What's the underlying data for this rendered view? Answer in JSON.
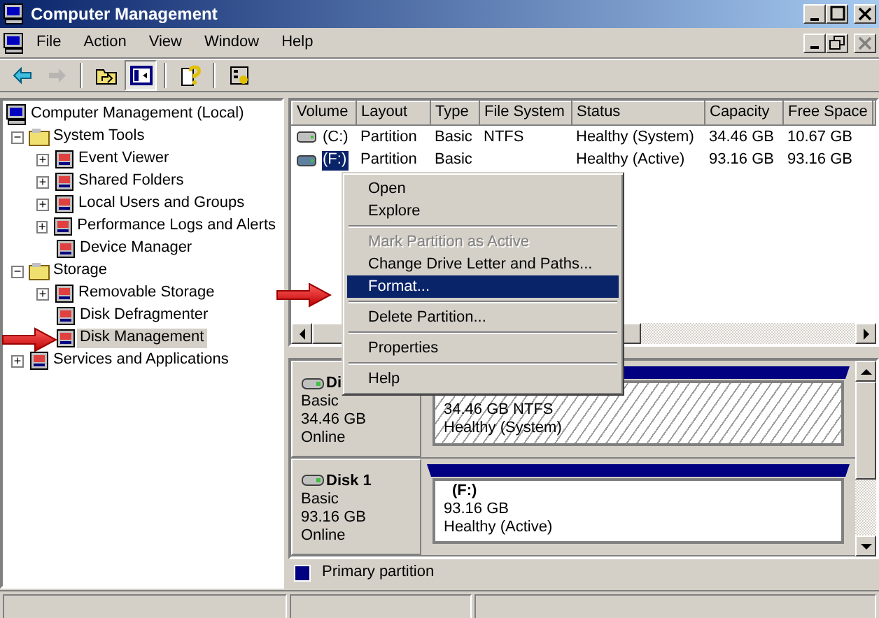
{
  "window": {
    "title": "Computer Management"
  },
  "menu_bar": [
    "File",
    "Action",
    "View",
    "Window",
    "Help"
  ],
  "toolbar": [
    {
      "kind": "back",
      "disabled": false,
      "pressed": false
    },
    {
      "kind": "forward",
      "disabled": true,
      "pressed": false
    },
    {
      "kind": "up",
      "disabled": false,
      "pressed": false
    },
    {
      "kind": "tree",
      "disabled": false,
      "pressed": true
    },
    {
      "kind": "help",
      "disabled": false,
      "pressed": false
    },
    {
      "kind": "properties",
      "disabled": false,
      "pressed": false
    }
  ],
  "tree": {
    "label": "Computer Management (Local)",
    "selected": false,
    "children": [
      {
        "label": "System Tools",
        "toggle": "−",
        "selected": false,
        "children": [
          {
            "label": "Event Viewer",
            "toggle": "+",
            "selected": false
          },
          {
            "label": "Shared Folders",
            "toggle": "+",
            "selected": false
          },
          {
            "label": "Local Users and Groups",
            "toggle": "+",
            "selected": false
          },
          {
            "label": "Performance Logs and Alerts",
            "toggle": "+",
            "selected": false
          },
          {
            "label": "Device Manager",
            "selected": false
          }
        ]
      },
      {
        "label": "Storage",
        "toggle": "−",
        "selected": false,
        "children": [
          {
            "label": "Removable Storage",
            "toggle": "+",
            "selected": false
          },
          {
            "label": "Disk Defragmenter",
            "selected": false
          },
          {
            "label": "Disk Management",
            "selected": true
          }
        ]
      },
      {
        "label": "Services and Applications",
        "toggle": "+",
        "selected": false
      }
    ]
  },
  "volumes": {
    "columns": [
      "Volume",
      "Layout",
      "Type",
      "File System",
      "Status",
      "Capacity",
      "Free Space"
    ],
    "rows": [
      {
        "cells": [
          "(C:)",
          "Partition",
          "Basic",
          "NTFS",
          "Healthy (System)",
          "34.46 GB",
          "10.67 GB"
        ],
        "selected": false
      },
      {
        "cells": [
          "(F:)",
          "Partition",
          "Basic",
          "",
          "Healthy (Active)",
          "93.16 GB",
          "93.16 GB"
        ],
        "selected": true
      }
    ]
  },
  "context_menu": [
    {
      "kind": "item",
      "label": "Open",
      "disabled": false,
      "selected": false
    },
    {
      "kind": "item",
      "label": "Explore",
      "disabled": false,
      "selected": false
    },
    {
      "kind": "separator"
    },
    {
      "kind": "item",
      "label": "Mark Partition as Active",
      "disabled": true,
      "selected": false
    },
    {
      "kind": "item",
      "label": "Change Drive Letter and Paths...",
      "disabled": false,
      "selected": false
    },
    {
      "kind": "item",
      "label": "Format...",
      "disabled": false,
      "selected": true
    },
    {
      "kind": "separator"
    },
    {
      "kind": "item",
      "label": "Delete Partition...",
      "disabled": false,
      "selected": false
    },
    {
      "kind": "separator"
    },
    {
      "kind": "item",
      "label": "Properties",
      "disabled": false,
      "selected": false
    },
    {
      "kind": "separator"
    },
    {
      "kind": "item",
      "label": "Help",
      "disabled": false,
      "selected": false
    }
  ],
  "disks": [
    {
      "name": "Di",
      "type": "Basic",
      "size": "34.46 GB",
      "state": "Online",
      "partition": {
        "size": "34.46 GB NTFS",
        "status": "Healthy (System)",
        "selected": true
      }
    },
    {
      "name": "Disk 1",
      "type": "Basic",
      "size": "93.16 GB",
      "state": "Online",
      "partition": {
        "label": "(F:)",
        "size": "93.16 GB",
        "status": "Healthy (Active)",
        "selected": false
      }
    }
  ],
  "legend": [
    {
      "label": "Primary partition",
      "color": "#000080"
    }
  ]
}
